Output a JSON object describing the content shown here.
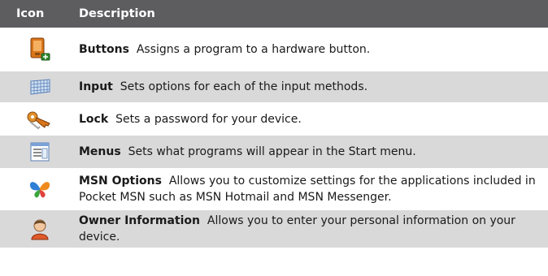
{
  "header": {
    "icon": "Icon",
    "description": "Description"
  },
  "rows": [
    {
      "icon": "buttons-icon",
      "title": "Buttons",
      "text": "Assigns a program to a hardware button."
    },
    {
      "icon": "input-keyboard-icon",
      "title": "Input",
      "text": "Sets options for each of the input methods."
    },
    {
      "icon": "lock-keys-icon",
      "title": "Lock",
      "text": "Sets a password for your device."
    },
    {
      "icon": "menus-icon",
      "title": "Menus",
      "text": "Sets what programs will appear in the Start menu."
    },
    {
      "icon": "msn-butterfly-icon",
      "title": "MSN Options",
      "text": "Allows you to customize settings for the applications included in Pocket MSN such as MSN Hotmail and MSN Messenger."
    },
    {
      "icon": "owner-person-icon",
      "title": "Owner Information",
      "text": "Allows you to enter your personal information on your device."
    }
  ],
  "colors": {
    "header_bg": "#5d5d60",
    "stripe": "#d9d9da"
  }
}
